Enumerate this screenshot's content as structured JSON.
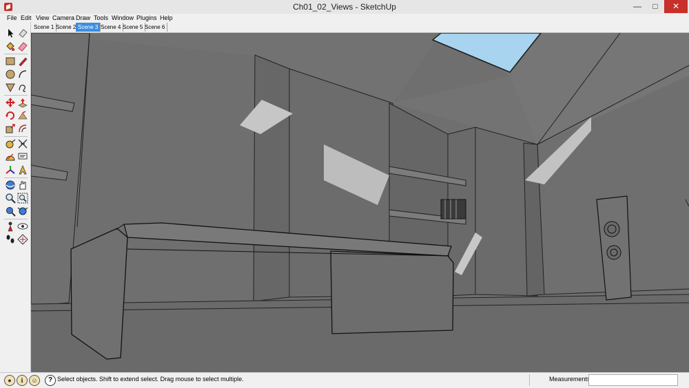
{
  "window": {
    "title": "Ch01_02_Views - SketchUp"
  },
  "menu": [
    "File",
    "Edit",
    "View",
    "Camera",
    "Draw",
    "Tools",
    "Window",
    "Plugins",
    "Help"
  ],
  "scenes": [
    {
      "label": "Scene 1",
      "active": false
    },
    {
      "label": "Scene 2",
      "active": false
    },
    {
      "label": "Scene 3",
      "active": true
    },
    {
      "label": "Scene 4",
      "active": false
    },
    {
      "label": "Scene 5",
      "active": false
    },
    {
      "label": "Scene 6",
      "active": false
    }
  ],
  "tools": [
    "select-icon",
    "eraser-icon",
    "paint-bucket-icon",
    "eraser-pink-icon",
    "rectangle-icon",
    "pencil-icon",
    "circle-icon",
    "arc-icon",
    "polygon-icon",
    "freehand-icon",
    "move-icon",
    "push-pull-icon",
    "rotate-icon",
    "follow-me-icon",
    "scale-icon",
    "offset-icon",
    "tape-measure-icon",
    "dimension-icon",
    "protractor-icon",
    "text-icon",
    "axes-icon",
    "3d-text-icon",
    "orbit-icon",
    "pan-icon",
    "zoom-icon",
    "zoom-window-icon",
    "zoom-extents-icon",
    "previous-view-icon",
    "position-camera-icon",
    "look-around-icon",
    "walk-icon",
    "section-plane-icon"
  ],
  "status": {
    "message": "Select objects. Shift to extend select. Drag mouse to select multiple.",
    "measurements_label": "Measurements",
    "measurements_value": ""
  },
  "colors": {
    "wall": "#6e6e6e",
    "sunlight": "#c6c6c6",
    "sky": "#a8d4ef",
    "active_scene": "#3b8ee0",
    "close_button": "#c7302b"
  }
}
